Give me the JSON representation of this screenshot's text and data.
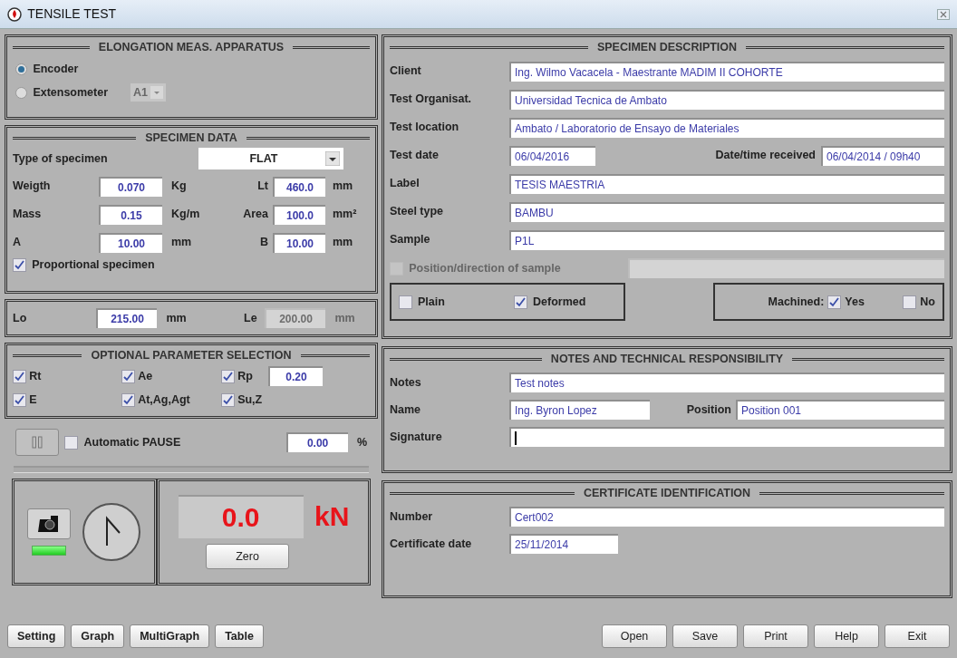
{
  "window": {
    "title": "TENSILE TEST"
  },
  "elongation": {
    "title": "ELONGATION MEAS. APPARATUS",
    "options": [
      {
        "label": "Encoder",
        "selected": true
      },
      {
        "label": "Extensometer",
        "selected": false
      }
    ],
    "extensometer_select": {
      "value": "A1",
      "disabled": true
    }
  },
  "specimen_data": {
    "title": "SPECIMEN DATA",
    "type_label": "Type of specimen",
    "type_value": "FLAT",
    "rows": [
      {
        "label": "Weigth",
        "value": "0.070",
        "unit": "Kg",
        "label2": "Lt",
        "value2": "460.0",
        "unit2": "mm"
      },
      {
        "label": "Mass",
        "value": "0.15",
        "unit": "Kg/m",
        "label2": "Area",
        "value2": "100.0",
        "unit2": "mm²"
      },
      {
        "label": "A",
        "value": "10.00",
        "unit": "mm",
        "label2": "B",
        "value2": "10.00",
        "unit2": "mm"
      }
    ],
    "proportional": {
      "label": "Proportional specimen",
      "checked": true
    }
  },
  "lengths": [
    {
      "label": "Lo",
      "value": "215.00",
      "unit": "mm",
      "disabled": false
    },
    {
      "label": "Le",
      "value": "200.00",
      "unit": "mm",
      "disabled": true
    }
  ],
  "optional": {
    "title": "OPTIONAL PARAMETER SELECTION",
    "params": [
      {
        "label": "Rt",
        "checked": true
      },
      {
        "label": "Ae",
        "checked": true
      },
      {
        "label": "Rp",
        "checked": true
      },
      {
        "label": "E",
        "checked": true
      },
      {
        "label": "At,Ag,Agt",
        "checked": true
      },
      {
        "label": "Su,Z",
        "checked": true
      }
    ],
    "rp_value": "0.20"
  },
  "pause": {
    "label": "Automatic PAUSE",
    "checked": false,
    "value": "0.00",
    "unit": "%"
  },
  "force": {
    "value": "0.0",
    "unit": "kN",
    "zero_button": "Zero"
  },
  "specimen_description": {
    "title": "SPECIMEN DESCRIPTION",
    "rows": [
      {
        "kind": "full",
        "label": "Client",
        "value": "Ing. Wilmo Vacacela - Maestrante MADIM II COHORTE"
      },
      {
        "kind": "full",
        "label": "Test Organisat.",
        "value": "Universidad Tecnica de Ambato"
      },
      {
        "kind": "full",
        "label": "Test location",
        "value": "Ambato / Laboratorio de Ensayo de Materiales"
      },
      {
        "kind": "pair",
        "label": "Test date",
        "value": "06/04/2016",
        "label2": "Date/time received",
        "value2": "06/04/2014 / 09h40"
      },
      {
        "kind": "full",
        "label": "Label",
        "value": "TESIS MAESTRIA"
      },
      {
        "kind": "full",
        "label": "Steel type",
        "value": "BAMBU"
      },
      {
        "kind": "full",
        "label": "Sample",
        "value": "P1L"
      }
    ],
    "position": {
      "label": "Position/direction of sample",
      "checked": false,
      "disabled": true
    },
    "surface": [
      {
        "label": "Plain",
        "checked": false
      },
      {
        "label": "Deformed",
        "checked": true
      }
    ],
    "machined": {
      "label": "Machined:",
      "options": [
        {
          "label": "Yes",
          "checked": true
        },
        {
          "label": "No",
          "checked": false
        }
      ]
    }
  },
  "notes": {
    "title": "NOTES AND TECHNICAL RESPONSIBILITY",
    "rows": [
      {
        "kind": "full",
        "label": "Notes",
        "value": "Test notes"
      },
      {
        "kind": "pair2",
        "label": "Name",
        "value": "Ing. Byron Lopez",
        "label2": "Position",
        "value2": "Position 001"
      },
      {
        "kind": "cursor",
        "label": "Signature"
      }
    ]
  },
  "certificate": {
    "title": "CERTIFICATE IDENTIFICATION",
    "rows": [
      {
        "kind": "full",
        "label": "Number",
        "value": "Cert002"
      },
      {
        "kind": "short",
        "label": "Certificate date",
        "value": "25/11/2014"
      }
    ]
  },
  "buttons_left": [
    "Setting",
    "Graph",
    "MultiGraph",
    "Table"
  ],
  "buttons_right": [
    "Open",
    "Save",
    "Print",
    "Help",
    "Exit"
  ]
}
